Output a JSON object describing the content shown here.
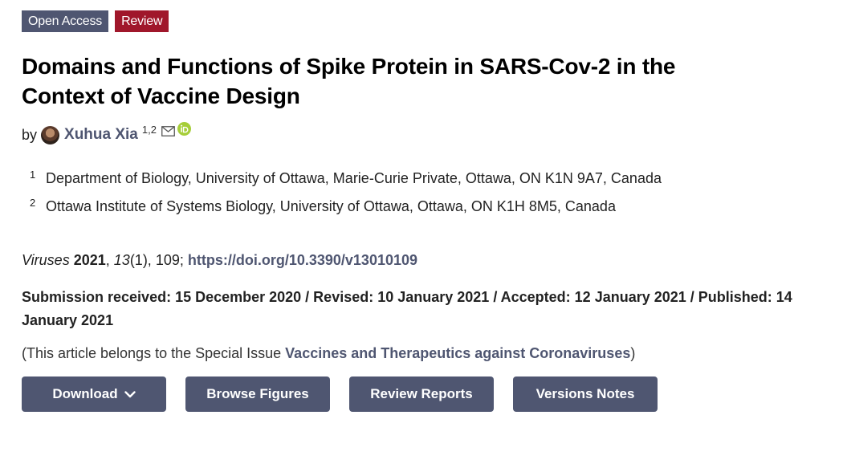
{
  "badges": {
    "open_access": "Open Access",
    "type": "Review"
  },
  "article": {
    "title": "Domains and Functions of Spike Protein in SARS-Cov-2 in the Context of Vaccine Design",
    "by_label": "by",
    "author": {
      "name": "Xuhua Xia",
      "affiliation_refs": "1,2"
    },
    "affiliations": [
      {
        "num": "1",
        "text": "Department of Biology, University of Ottawa, Marie-Curie Private, Ottawa, ON K1N 9A7, Canada"
      },
      {
        "num": "2",
        "text": "Ottawa Institute of Systems Biology, University of Ottawa, Ottawa, ON K1H 8M5, Canada"
      }
    ],
    "citation": {
      "journal": "Viruses",
      "year": "2021",
      "volume": "13",
      "issue_pages": "(1), 109;",
      "doi": "https://doi.org/10.3390/v13010109"
    },
    "dates": "Submission received: 15 December 2020 / Revised: 10 January 2021 / Accepted: 12 January 2021 / Published: 14 January 2021",
    "special_issue": {
      "prefix": "(This article belongs to the Special Issue ",
      "name": "Vaccines and Therapeutics against Coronaviruses",
      "suffix": ")"
    }
  },
  "actions": {
    "download": "Download",
    "browse_figures": "Browse Figures",
    "review_reports": "Review Reports",
    "versions_notes": "Versions Notes"
  },
  "colors": {
    "accent": "#4f5671",
    "review_badge": "#a0172b",
    "orcid": "#a6ce39"
  },
  "icons": {
    "mail": "envelope-icon",
    "orcid": "orcid-icon",
    "chevron": "chevron-down-icon"
  }
}
